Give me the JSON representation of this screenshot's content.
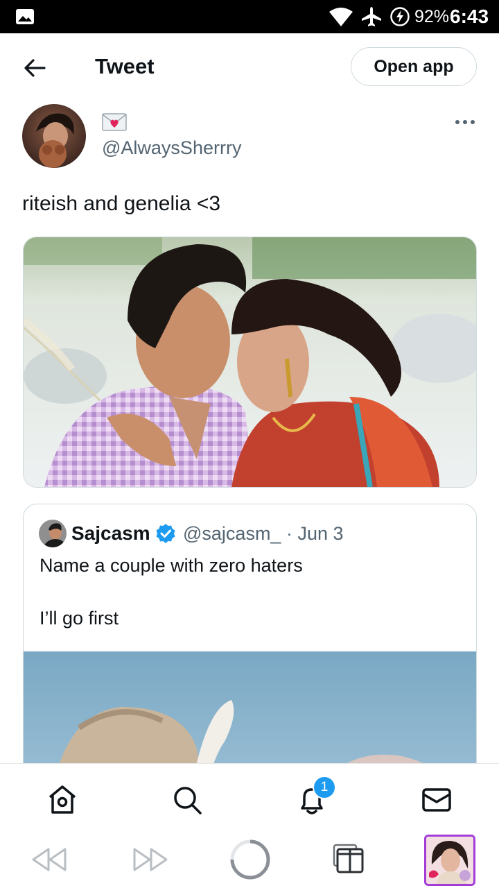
{
  "status_bar": {
    "battery": "92%",
    "time": "6:43"
  },
  "header": {
    "title": "Tweet",
    "open_app_label": "Open app"
  },
  "tweet": {
    "author_emoji": "💌",
    "author_handle": "@AlwaysSherrry",
    "text": "riteish and genelia <3"
  },
  "quote": {
    "name": "Sajcasm",
    "handle_date": "@sajcasm_ · Jun 3",
    "line1": "Name a couple with zero haters",
    "line2": "I’ll go first"
  },
  "nav": {
    "notifications_badge": "1"
  },
  "colors": {
    "accent": "#1d9bf0",
    "text": "#0f1419",
    "secondary": "#536471",
    "border": "#cfd9de"
  }
}
